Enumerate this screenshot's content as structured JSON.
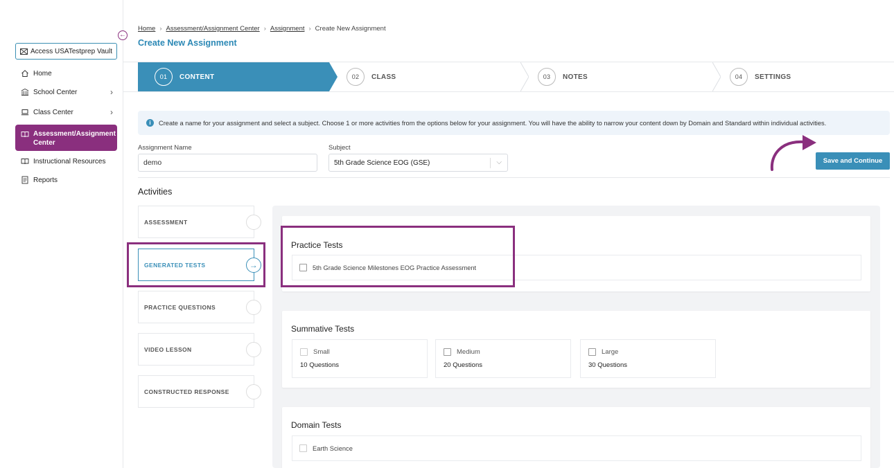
{
  "sidebar": {
    "vault_label": "Access USATestprep Vault",
    "items": [
      {
        "label": "Home"
      },
      {
        "label": "School Center"
      },
      {
        "label": "Class Center"
      },
      {
        "label": "Assessment/Assignment Center"
      },
      {
        "label": "Instructional Resources"
      },
      {
        "label": "Reports"
      }
    ]
  },
  "breadcrumb": [
    "Home",
    "Assessment/Assignment Center",
    "Assignment",
    "Create New Assignment"
  ],
  "page_title": "Create New Assignment",
  "stepper": [
    {
      "num": "01",
      "label": "CONTENT"
    },
    {
      "num": "02",
      "label": "CLASS"
    },
    {
      "num": "03",
      "label": "NOTES"
    },
    {
      "num": "04",
      "label": "SETTINGS"
    }
  ],
  "info_text": "Create a name for your assignment and select a subject. Choose 1 or more activities from the options below for your assignment. You will have the ability to narrow your content down by Domain and Standard within individual activities.",
  "form": {
    "name_label": "Assignment Name",
    "name_value": "demo",
    "subject_label": "Subject",
    "subject_value": "5th Grade Science EOG (GSE)",
    "save_label": "Save and Continue"
  },
  "activities": {
    "title": "Activities",
    "items": [
      {
        "label": "ASSESSMENT"
      },
      {
        "label": "GENERATED TESTS"
      },
      {
        "label": "PRACTICE QUESTIONS"
      },
      {
        "label": "VIDEO LESSON"
      },
      {
        "label": "CONSTRUCTED RESPONSE"
      }
    ]
  },
  "practice_tests": {
    "title": "Practice Tests",
    "option": "5th Grade Science Milestones EOG Practice Assessment"
  },
  "summative_tests": {
    "title": "Summative Tests",
    "options": [
      {
        "label": "Small",
        "count": "10 Questions"
      },
      {
        "label": "Medium",
        "count": "20 Questions"
      },
      {
        "label": "Large",
        "count": "30 Questions"
      }
    ]
  },
  "domain_tests": {
    "title": "Domain Tests",
    "options": [
      "Earth Science"
    ]
  },
  "colors": {
    "accent": "#3a8fb8",
    "brand": "#8a2f7e"
  }
}
